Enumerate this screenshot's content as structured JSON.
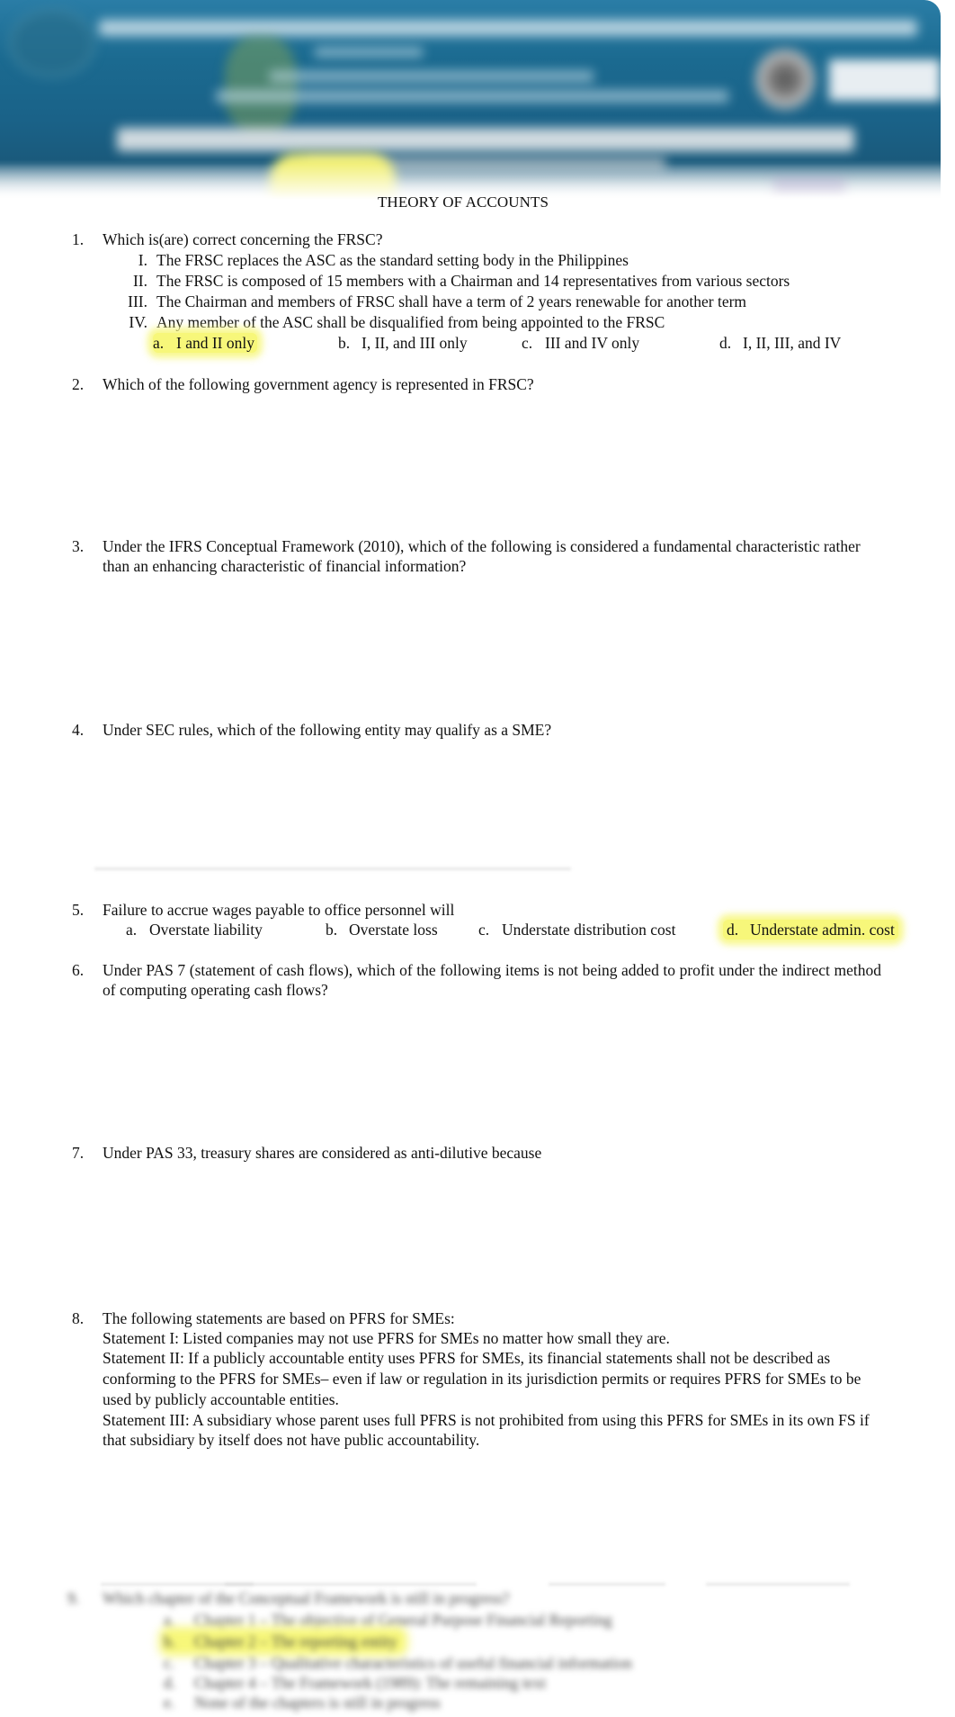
{
  "document": {
    "title": "THEORY OF ACCOUNTS",
    "banner_icon": "exam-banner-image"
  },
  "questions": [
    {
      "number": "1.",
      "text": "Which is(are) correct concerning the FRSC?",
      "statements": [
        {
          "numeral": "I.",
          "text": "The FRSC replaces the ASC as the standard setting body in the Philippines"
        },
        {
          "numeral": "II.",
          "text": "The FRSC is composed of 15 members with a Chairman and 14 representatives from various sectors"
        },
        {
          "numeral": "III.",
          "text": "The Chairman and members of FRSC shall have a term of 2 years renewable for another term"
        },
        {
          "numeral": "IV.",
          "text": "Any member of the ASC shall be disqualified from being appointed to the FRSC"
        }
      ],
      "options": [
        {
          "letter": "a.",
          "text": "I and II only",
          "highlighted": true
        },
        {
          "letter": "b.",
          "text": "I, II, and III only",
          "highlighted": false
        },
        {
          "letter": "c.",
          "text": "III and IV only",
          "highlighted": false
        },
        {
          "letter": "d.",
          "text": "I, II, III, and IV",
          "highlighted": false
        }
      ]
    },
    {
      "number": "2.",
      "text": "Which of the following government agency is represented in FRSC?"
    },
    {
      "number": "3.",
      "text": "Under the IFRS Conceptual Framework (2010), which of the following is considered a fundamental characteristic rather than an enhancing characteristic of financial information?"
    },
    {
      "number": "4.",
      "text": "Under SEC rules, which of the following entity may qualify as a SME?"
    },
    {
      "number": "5.",
      "text": "Failure to accrue wages payable to office personnel will",
      "options": [
        {
          "letter": "a.",
          "text": "Overstate liability",
          "highlighted": false
        },
        {
          "letter": "b.",
          "text": "Overstate loss",
          "highlighted": false
        },
        {
          "letter": "c.",
          "text": "Understate distribution cost",
          "highlighted": false
        },
        {
          "letter": "d.",
          "text": "Understate admin. cost",
          "highlighted": true
        }
      ]
    },
    {
      "number": "6.",
      "text": "Under PAS 7 (statement of cash flows), which of the following items is not being added to profit under the indirect method of computing operating cash flows?"
    },
    {
      "number": "7.",
      "text": "Under PAS 33, treasury shares are considered as anti-dilutive because"
    },
    {
      "number": "8.",
      "text": "The following statements are based on PFRS for SMEs:",
      "statements": [
        {
          "text": "Statement I: Listed companies may not use PFRS for SMEs no matter how small they are."
        },
        {
          "text": "Statement II: If a publicly accountable entity uses PFRS for SMEs, its financial statements shall not be described as conforming to the PFRS for SMEs– even if law or regulation in its jurisdiction permits or requires PFRS for SMEs to be used by publicly accountable entities."
        },
        {
          "text": "Statement III: A subsidiary whose parent uses full PFRS is not prohibited from using this PFRS for SMEs in its own FS if that subsidiary by itself does not have public accountability."
        }
      ]
    }
  ],
  "blurred_question": {
    "number": "9.",
    "text": "Which chapter of the Conceptual Framework is still in progress?",
    "options": [
      {
        "letter": "a.",
        "text": "Chapter 1 – The objective of General Purpose Financial Reporting",
        "highlighted": false
      },
      {
        "letter": "b.",
        "text": "Chapter 2 – The reporting entity",
        "highlighted": true
      },
      {
        "letter": "c.",
        "text": "Chapter 3 – Qualitative characteristics of useful financial information",
        "highlighted": false
      },
      {
        "letter": "d.",
        "text": "Chapter 4 – The Framework (1989): The remaining text",
        "highlighted": false
      },
      {
        "letter": "e.",
        "text": "None of the chapters is still in progress",
        "highlighted": false
      }
    ]
  }
}
